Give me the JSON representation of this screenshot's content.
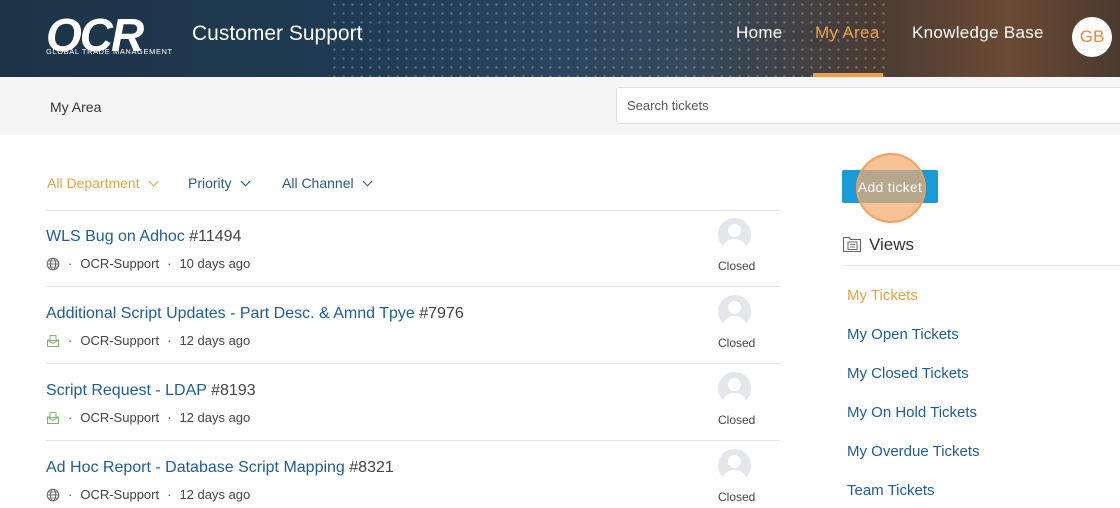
{
  "header": {
    "logo_text": "OCR",
    "logo_sub": "GLOBAL TRADE MANAGEMENT",
    "title": "Customer Support",
    "nav": [
      {
        "label": "Home",
        "active": false
      },
      {
        "label": "My Area",
        "active": true
      },
      {
        "label": "Knowledge Base",
        "active": false
      }
    ],
    "avatar_initials": "GB"
  },
  "subbar": {
    "breadcrumb": "My Area",
    "search_placeholder": "Search tickets"
  },
  "filters": [
    {
      "label": "All Department",
      "icon": "chevron-down-icon"
    },
    {
      "label": "Priority",
      "icon": "chevron-down-icon"
    },
    {
      "label": "All Channel",
      "icon": "chevron-down-icon"
    }
  ],
  "tickets": [
    {
      "title": "WLS Bug on Adhoc",
      "id": "#11494",
      "channel_icon": "globe-icon",
      "department": "OCR-Support",
      "age": "10 days ago",
      "status": "Closed"
    },
    {
      "title": "Additional Script Updates - Part Desc. & Amnd Tpye",
      "id": "#7976",
      "channel_icon": "email-icon",
      "department": "OCR-Support",
      "age": "12 days ago",
      "status": "Closed"
    },
    {
      "title": "Script Request - LDAP",
      "id": "#8193",
      "channel_icon": "email-icon",
      "department": "OCR-Support",
      "age": "12 days ago",
      "status": "Closed"
    },
    {
      "title": "Ad Hoc Report - Database Script Mapping",
      "id": "#8321",
      "channel_icon": "globe-icon",
      "department": "OCR-Support",
      "age": "12 days ago",
      "status": "Closed"
    }
  ],
  "meta_separator": "·",
  "sidebar": {
    "add_ticket_label": "Add ticket",
    "views_title": "Views",
    "views": [
      {
        "label": "My Tickets",
        "active": true
      },
      {
        "label": "My Open Tickets",
        "active": false
      },
      {
        "label": "My Closed Tickets",
        "active": false
      },
      {
        "label": "My On Hold Tickets",
        "active": false
      },
      {
        "label": "My Overdue Tickets",
        "active": false
      },
      {
        "label": "Team Tickets",
        "active": false
      }
    ]
  },
  "colors": {
    "accent_orange": "#f0a04b",
    "link_blue": "#1f5d96",
    "button_blue": "#1a9bd7"
  }
}
